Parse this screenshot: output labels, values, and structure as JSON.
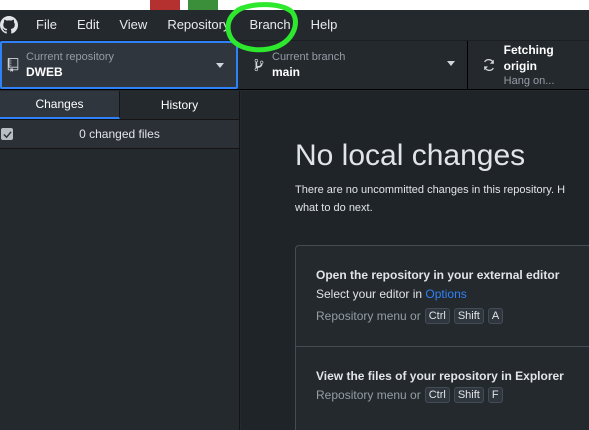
{
  "menu": {
    "items": [
      "File",
      "Edit",
      "View",
      "Repository",
      "Branch",
      "Help"
    ]
  },
  "toolbar": {
    "repo_label": "Current repository",
    "repo_value": "DWEB",
    "branch_label": "Current branch",
    "branch_value": "main",
    "fetch_label": "Fetching origin",
    "fetch_sub": "Hang on..."
  },
  "sidebar": {
    "tabs": [
      "Changes",
      "History"
    ],
    "changed_files": "0 changed files"
  },
  "main": {
    "title": "No local changes",
    "subtitle_line1": "There are no uncommitted changes in this repository. H",
    "subtitle_line2": "what to do next.",
    "card1": {
      "title": "Open the repository in your external editor",
      "line_prefix": "Select your editor in",
      "link": "Options",
      "hint": "Repository menu or",
      "keys": [
        "Ctrl",
        "Shift",
        "A"
      ]
    },
    "card2": {
      "title": "View the files of your repository in Explorer",
      "hint": "Repository menu or",
      "keys": [
        "Ctrl",
        "Shift",
        "F"
      ]
    }
  },
  "colors": {
    "accent": "#2f81f7",
    "annotation": "#2ee82e",
    "background": "#24292e"
  },
  "icons": {
    "logo": "github-logo-icon",
    "repo": "repository-icon",
    "branch": "git-branch-icon",
    "fetch": "sync-icon"
  }
}
